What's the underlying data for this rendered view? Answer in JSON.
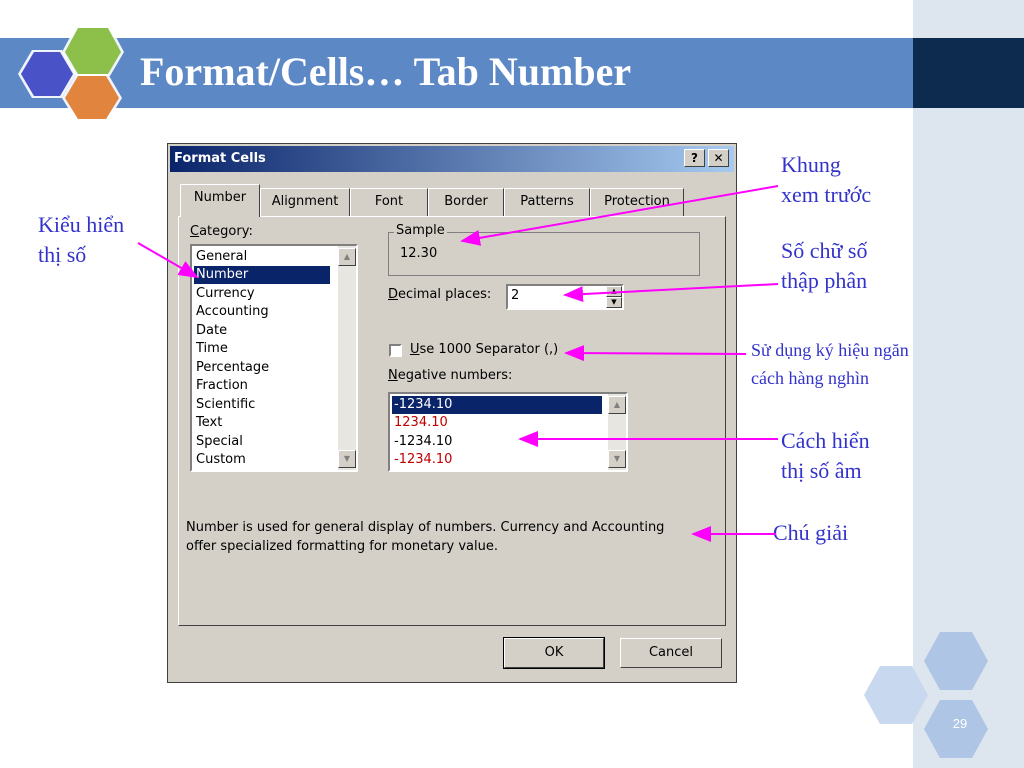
{
  "slide": {
    "title": "Format/Cells… Tab Number",
    "page_number": "29",
    "colors": {
      "title_bar": "#5d88c6",
      "title_dark": "#0d2a4f",
      "hex_green": "#8cc04a",
      "hex_blue": "#4a52c8",
      "hex_orange": "#e0843e",
      "annotation": "#3333cc",
      "arrow": "#ff00ff"
    }
  },
  "dialog": {
    "title": "Format Cells",
    "help_button": "?",
    "close_button": "✕",
    "tabs": [
      {
        "label": "Number",
        "active": true
      },
      {
        "label": "Alignment",
        "active": false
      },
      {
        "label": "Font",
        "active": false
      },
      {
        "label": "Border",
        "active": false
      },
      {
        "label": "Patterns",
        "active": false
      },
      {
        "label": "Protection",
        "active": false
      }
    ],
    "category": {
      "label_mnemonic": "C",
      "label_rest": "ategory:",
      "items": [
        "General",
        "Number",
        "Currency",
        "Accounting",
        "Date",
        "Time",
        "Percentage",
        "Fraction",
        "Scientific",
        "Text",
        "Special",
        "Custom"
      ],
      "selected": "Number"
    },
    "sample": {
      "label": "Sample",
      "value": "12.30"
    },
    "decimal_places": {
      "label_mnemonic": "D",
      "label_rest": "ecimal places:",
      "value": "2"
    },
    "separator": {
      "label_mnemonic": "U",
      "label_rest": "se 1000 Separator (,)",
      "checked": false
    },
    "negative_numbers": {
      "label_mnemonic": "N",
      "label_rest": "egative numbers:",
      "items": [
        {
          "text": "-1234.10",
          "red": false,
          "selected": true
        },
        {
          "text": "1234.10",
          "red": true,
          "selected": false
        },
        {
          "text": "-1234.10",
          "red": false,
          "selected": false
        },
        {
          "text": "-1234.10",
          "red": true,
          "selected": false
        }
      ]
    },
    "description_line1": "Number is used for general display of numbers.  Currency and Accounting",
    "description_line2": "offer specialized formatting for monetary value.",
    "ok_label": "OK",
    "cancel_label": "Cancel"
  },
  "annotations": {
    "preview_line1": "Khung",
    "preview_line2": "xem trước",
    "decimals_line1": "Số chữ số",
    "decimals_line2": "thập phân",
    "separator_line1": "Sử dụng ký hiệu ngăn",
    "separator_line2": "cách hàng nghìn",
    "negative_line1": "Cách hiển",
    "negative_line2": "thị số âm",
    "legend": "Chú giải",
    "category_line1": "Kiểu hiển",
    "category_line2": "thị số"
  }
}
